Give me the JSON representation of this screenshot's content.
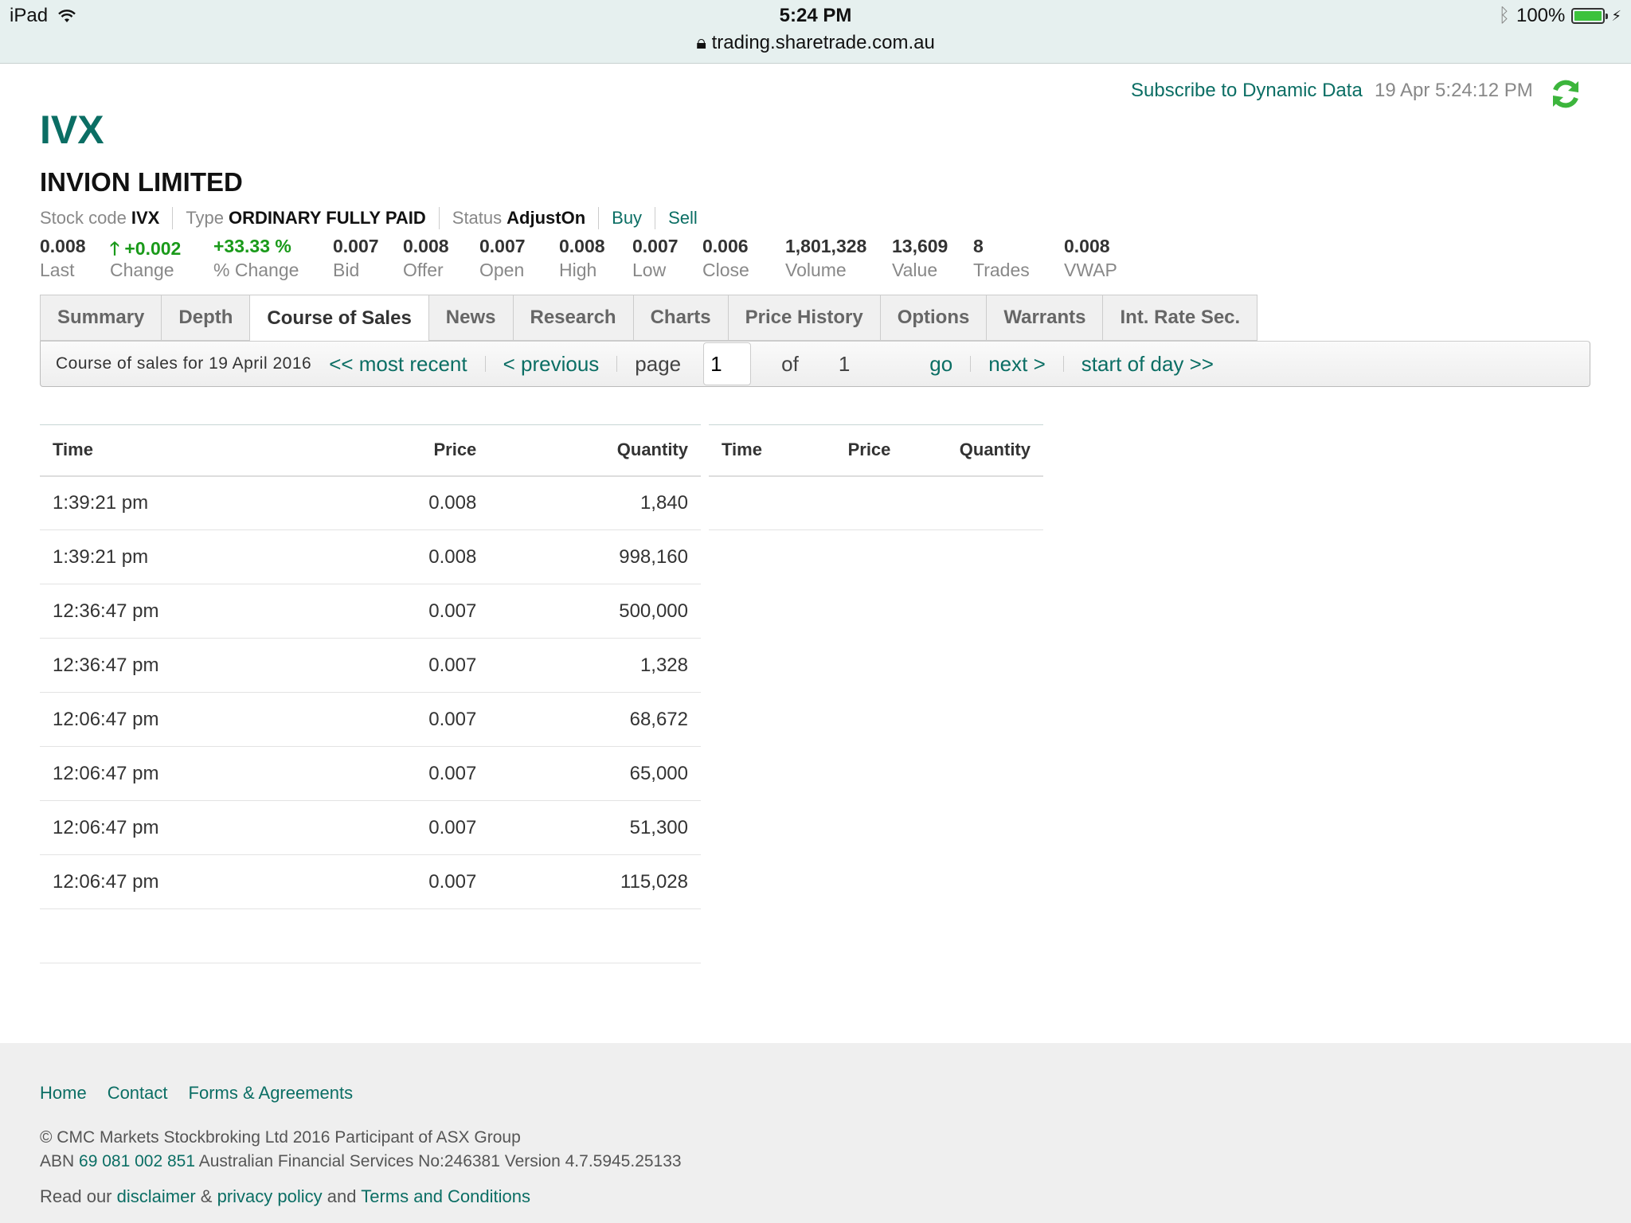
{
  "statusbar": {
    "device": "iPad",
    "time": "5:24 PM",
    "url": "trading.sharetrade.com.au",
    "battery": "100%"
  },
  "header": {
    "subscribe_link": "Subscribe to Dynamic Data",
    "timestamp": "19 Apr 5:24:12 PM",
    "stock_code": "IVX",
    "company": "INVION LIMITED"
  },
  "meta": {
    "stock_code_label": "Stock code",
    "stock_code": "IVX",
    "type_label": "Type",
    "type": "ORDINARY FULLY PAID",
    "status_label": "Status",
    "status": "AdjustOn",
    "buy": "Buy",
    "sell": "Sell"
  },
  "stats": [
    {
      "value": "0.008",
      "label": "Last"
    },
    {
      "value": "+0.002",
      "label": "Change"
    },
    {
      "value": "+33.33 %",
      "label": "% Change"
    },
    {
      "value": "0.007",
      "label": "Bid"
    },
    {
      "value": "0.008",
      "label": "Offer"
    },
    {
      "value": "0.007",
      "label": "Open"
    },
    {
      "value": "0.008",
      "label": "High"
    },
    {
      "value": "0.007",
      "label": "Low"
    },
    {
      "value": "0.006",
      "label": "Close"
    },
    {
      "value": "1,801,328",
      "label": "Volume"
    },
    {
      "value": "13,609",
      "label": "Value"
    },
    {
      "value": "8",
      "label": "Trades"
    },
    {
      "value": "0.008",
      "label": "VWAP"
    }
  ],
  "tabs": [
    "Summary",
    "Depth",
    "Course of Sales",
    "News",
    "Research",
    "Charts",
    "Price History",
    "Options",
    "Warrants",
    "Int. Rate Sec."
  ],
  "pager": {
    "description": "Course of sales for 19 April 2016",
    "most_recent": "<< most recent",
    "previous": "< previous",
    "page_label": "page",
    "page_value": "1",
    "of_label": "of",
    "total": "1",
    "go": "go",
    "next": "next >",
    "start_of_day": "start of day >>"
  },
  "table": {
    "headers": [
      "Time",
      "Price",
      "Quantity"
    ],
    "rows": [
      [
        "1:39:21 pm",
        "0.008",
        "1,840"
      ],
      [
        "1:39:21 pm",
        "0.008",
        "998,160"
      ],
      [
        "12:36:47 pm",
        "0.007",
        "500,000"
      ],
      [
        "12:36:47 pm",
        "0.007",
        "1,328"
      ],
      [
        "12:06:47 pm",
        "0.007",
        "68,672"
      ],
      [
        "12:06:47 pm",
        "0.007",
        "65,000"
      ],
      [
        "12:06:47 pm",
        "0.007",
        "51,300"
      ],
      [
        "12:06:47 pm",
        "0.007",
        "115,028"
      ]
    ]
  },
  "footer": {
    "links": [
      "Home",
      "Contact",
      "Forms & Agreements"
    ],
    "copyright": "© CMC Markets Stockbroking Ltd 2016 Participant of ASX Group",
    "abn_label": "ABN",
    "abn": "69 081 002 851",
    "afs": "Australian Financial Services No:246381 Version 4.7.5945.25133",
    "read_our": "Read our",
    "disclaimer": "disclaimer",
    "amp": "&",
    "privacy": "privacy policy",
    "and": "and",
    "terms": "Terms and Conditions"
  },
  "colors": {
    "accent": "#0b6e64",
    "positive": "#1a9a1a"
  }
}
